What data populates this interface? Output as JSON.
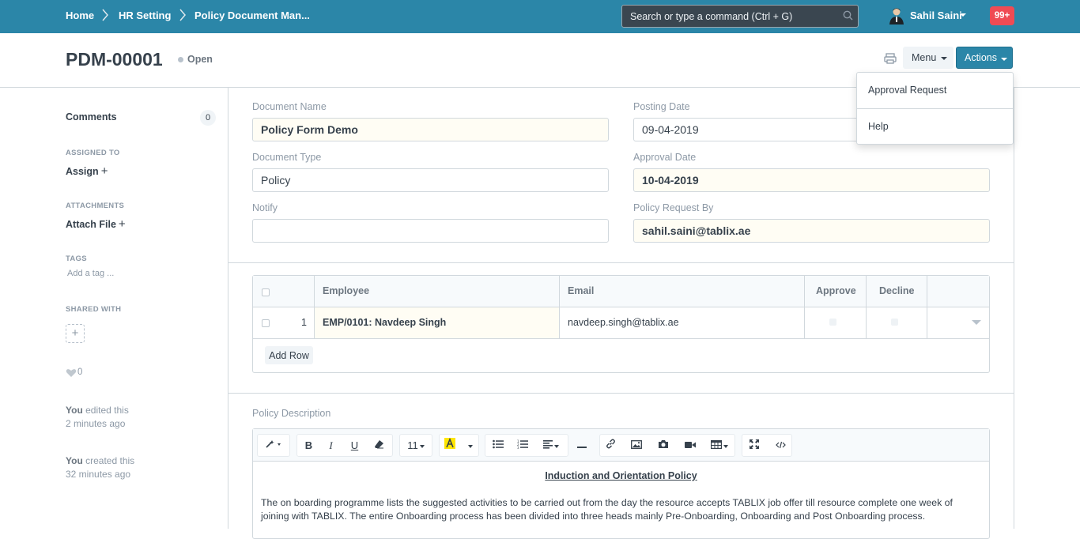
{
  "navbar": {
    "breadcrumbs": [
      "Home",
      "HR Setting",
      "Policy Document Man..."
    ],
    "search_placeholder": "Search or type a command (Ctrl + G)",
    "user_name": "Sahil Saini",
    "notification_count": "99+",
    "color": "#2b86a8"
  },
  "page": {
    "title": "PDM-00001",
    "status": "Open",
    "menu_label": "Menu",
    "actions_label": "Actions"
  },
  "actions_dropdown": [
    "Approval Request",
    "Help"
  ],
  "sidebar": {
    "comments_label": "Comments",
    "comments_count": "0",
    "assigned_to_label": "ASSIGNED TO",
    "assign_label": "Assign",
    "attachments_label": "ATTACHMENTS",
    "attach_label": "Attach File",
    "tags_label": "TAGS",
    "tag_placeholder": "Add a tag ...",
    "shared_label": "SHARED WITH",
    "likes": "0",
    "activity": [
      {
        "user": "You",
        "action": "edited this",
        "time": "2 minutes ago"
      },
      {
        "user": "You",
        "action": "created this",
        "time": "32 minutes ago"
      }
    ]
  },
  "form": {
    "document_name": {
      "label": "Document Name",
      "value": "Policy Form Demo"
    },
    "posting_date": {
      "label": "Posting Date",
      "value": "09-04-2019"
    },
    "document_type": {
      "label": "Document Type",
      "value": "Policy"
    },
    "approval_date": {
      "label": "Approval Date",
      "value": "10-04-2019"
    },
    "notify": {
      "label": "Notify",
      "value": ""
    },
    "policy_request_by": {
      "label": "Policy Request By",
      "value": "sahil.saini@tablix.ae"
    }
  },
  "table": {
    "headers": {
      "employee": "Employee",
      "email": "Email",
      "approve": "Approve",
      "decline": "Decline"
    },
    "rows": [
      {
        "idx": "1",
        "employee": "EMP/0101: Navdeep Singh",
        "email": "navdeep.singh@tablix.ae"
      }
    ],
    "add_row_label": "Add Row"
  },
  "editor": {
    "label": "Policy Description",
    "font_size": "11",
    "title": "Induction and Orientation Policy",
    "paragraph": "The on boarding programme lists the suggested activities to be carried out from the day the resource accepts TABLIX job offer till resource complete one week of joining with TABLIX. The entire Onboarding process has been divided into three heads mainly Pre-Onboarding, Onboarding and Post Onboarding process."
  }
}
